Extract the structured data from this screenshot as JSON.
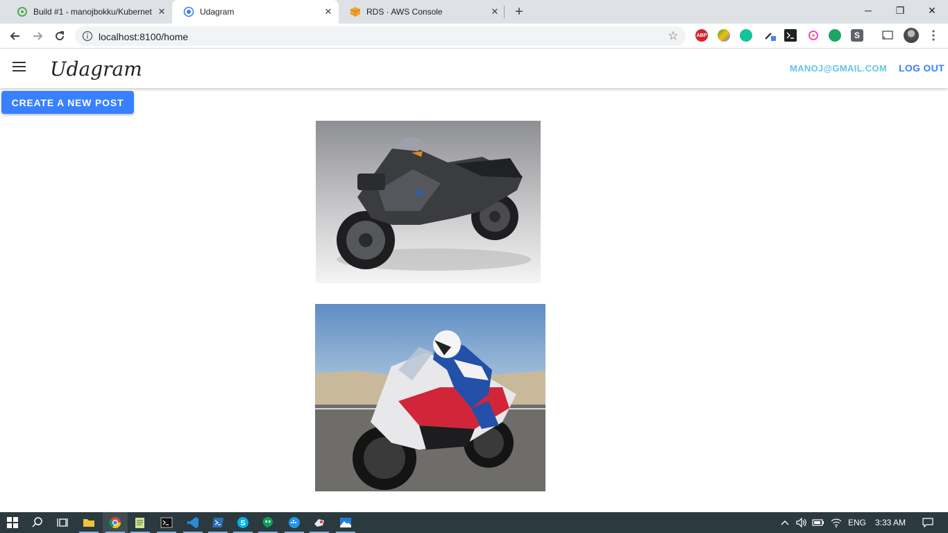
{
  "browser": {
    "tabs": [
      {
        "title": "Build #1 - manojbokku/Kubernet",
        "active": false
      },
      {
        "title": "Udagram",
        "active": true
      },
      {
        "title": "RDS · AWS Console",
        "active": false
      }
    ],
    "url": "localhost:8100/home",
    "close_glyph": "✕",
    "new_tab_glyph": "+",
    "minimize_glyph": "─",
    "restore_glyph": "❐",
    "win_close_glyph": "✕",
    "star_glyph": "☆"
  },
  "extensions": [
    "ABP",
    "",
    "",
    "",
    "",
    "",
    "",
    "S"
  ],
  "app": {
    "logo": "Udagram",
    "user_email": "MANOJ@GMAIL.COM",
    "logout_label": "LOG OUT",
    "create_post_label": "CREATE A NEW POST",
    "colors": {
      "primary": "#3880ff",
      "secondary": "#65c4e3"
    }
  },
  "feed": {
    "posts": [
      {
        "image": "photo of grey BMW sport-touring motorcycle on grey studio background"
      },
      {
        "image": "photo of rider leaning on red, white and black BMW superbike on track"
      }
    ]
  },
  "taskbar": {
    "language": "ENG",
    "time": "3:33 AM"
  }
}
